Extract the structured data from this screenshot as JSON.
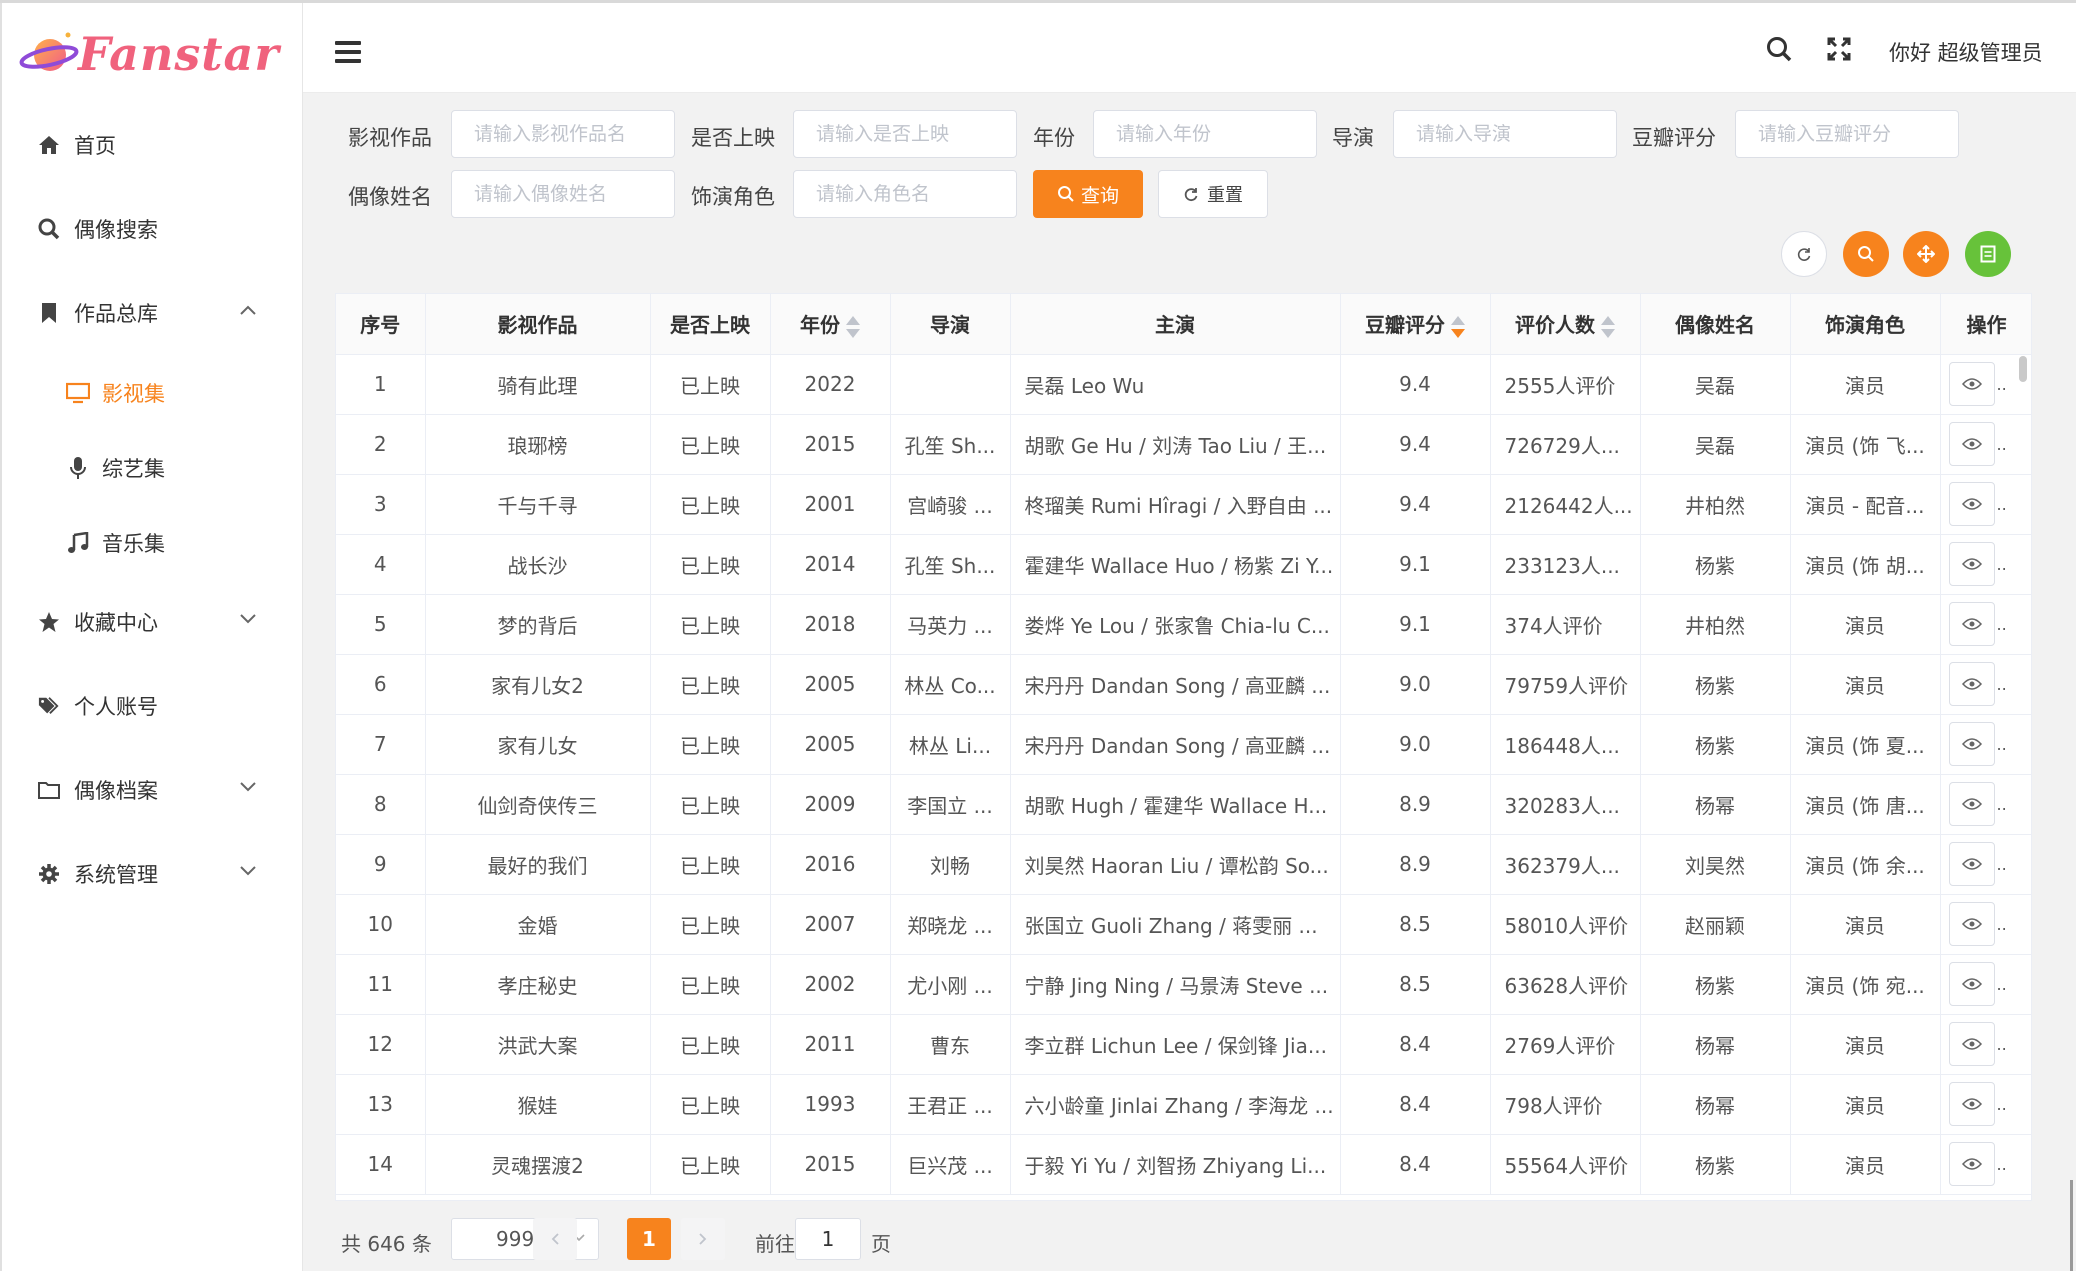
{
  "app": {
    "brand": "Fanstar"
  },
  "header": {
    "greeting": "你好 超级管理员"
  },
  "sidebar": {
    "items": [
      {
        "label": "首页"
      },
      {
        "label": "偶像搜索"
      },
      {
        "label": "作品总库"
      },
      {
        "label": "影视集"
      },
      {
        "label": "综艺集"
      },
      {
        "label": "音乐集"
      },
      {
        "label": "收藏中心"
      },
      {
        "label": "个人账号"
      },
      {
        "label": "偶像档案"
      },
      {
        "label": "系统管理"
      }
    ]
  },
  "filters": {
    "work": {
      "label": "影视作品",
      "placeholder": "请输入影视作品名"
    },
    "released": {
      "label": "是否上映",
      "placeholder": "请输入是否上映"
    },
    "year": {
      "label": "年份",
      "placeholder": "请输入年份"
    },
    "director": {
      "label": "导演",
      "placeholder": "请输入导演"
    },
    "rating": {
      "label": "豆瓣评分",
      "placeholder": "请输入豆瓣评分"
    },
    "idol": {
      "label": "偶像姓名",
      "placeholder": "请输入偶像姓名"
    },
    "role": {
      "label": "饰演角色",
      "placeholder": "请输入角色名"
    },
    "query_label": "查询",
    "reset_label": "重置"
  },
  "colors": {
    "accent": "#f7831d",
    "success": "#67c23a",
    "brand_pink": "#f0627d"
  },
  "table": {
    "headers": [
      "序号",
      "影视作品",
      "是否上映",
      "年份",
      "导演",
      "主演",
      "豆瓣评分",
      "评价人数",
      "偶像姓名",
      "饰演角色",
      "操作"
    ],
    "rows": [
      [
        "1",
        "骑有此理",
        "已上映",
        "2022",
        "",
        "吴磊 Leo Wu",
        "9.4",
        "2555人评价",
        "吴磊",
        "演员"
      ],
      [
        "2",
        "琅琊榜",
        "已上映",
        "2015",
        "孔笙 Sh...",
        "胡歌 Ge Hu / 刘涛 Tao Liu / 王...",
        "9.4",
        "726729人...",
        "吴磊",
        "演员 (饰 飞..."
      ],
      [
        "3",
        "千与千寻",
        "已上映",
        "2001",
        "宫崎骏 ...",
        "柊瑠美 Rumi Hîragi / 入野自由 ...",
        "9.4",
        "2126442人...",
        "井柏然",
        "演员 - 配音..."
      ],
      [
        "4",
        "战长沙",
        "已上映",
        "2014",
        "孔笙 Sh...",
        "霍建华 Wallace Huo / 杨紫 Zi Y...",
        "9.1",
        "233123人...",
        "杨紫",
        "演员 (饰 胡..."
      ],
      [
        "5",
        "梦的背后",
        "已上映",
        "2018",
        "马英力 ...",
        "娄烨 Ye Lou / 张家鲁 Chia-lu C...",
        "9.1",
        "374人评价",
        "井柏然",
        "演员"
      ],
      [
        "6",
        "家有儿女2",
        "已上映",
        "2005",
        "林丛 Co...",
        "宋丹丹 Dandan Song / 高亚麟 ...",
        "9.0",
        "79759人评价",
        "杨紫",
        "演员"
      ],
      [
        "7",
        "家有儿女",
        "已上映",
        "2005",
        "林丛 Li...",
        "宋丹丹 Dandan Song / 高亚麟 ...",
        "9.0",
        "186448人...",
        "杨紫",
        "演员 (饰 夏..."
      ],
      [
        "8",
        "仙剑奇侠传三",
        "已上映",
        "2009",
        "李国立 ...",
        "胡歌 Hugh / 霍建华 Wallace H...",
        "8.9",
        "320283人...",
        "杨幂",
        "演员 (饰 唐..."
      ],
      [
        "9",
        "最好的我们",
        "已上映",
        "2016",
        "刘畅",
        "刘昊然 Haoran Liu / 谭松韵 So...",
        "8.9",
        "362379人...",
        "刘昊然",
        "演员 (饰 余..."
      ],
      [
        "10",
        "金婚",
        "已上映",
        "2007",
        "郑晓龙 ...",
        "张国立 Guoli Zhang / 蒋雯丽 ...",
        "8.5",
        "58010人评价",
        "赵丽颖",
        "演员"
      ],
      [
        "11",
        "孝庄秘史",
        "已上映",
        "2002",
        "尤小刚 ...",
        "宁静 Jing Ning / 马景涛 Steve ...",
        "8.5",
        "63628人评价",
        "杨紫",
        "演员 (饰 宛..."
      ],
      [
        "12",
        "洪武大案",
        "已上映",
        "2011",
        "曹东",
        "李立群 Lichun Lee / 保剑锋 Jia...",
        "8.4",
        "2769人评价",
        "杨幂",
        "演员"
      ],
      [
        "13",
        "猴娃",
        "已上映",
        "1993",
        "王君正 ...",
        "六小龄童 Jinlai Zhang / 李海龙 ...",
        "8.4",
        "798人评价",
        "杨幂",
        "演员"
      ],
      [
        "14",
        "灵魂摆渡2",
        "已上映",
        "2015",
        "巨兴茂 ...",
        "于毅 Yi Yu / 刘智扬 Zhiyang Li...",
        "8.4",
        "55564人评价",
        "杨紫",
        "演员"
      ]
    ]
  },
  "pagination": {
    "total": "共 646 条",
    "page_size": "999",
    "current": "1",
    "goto_label": "前往",
    "goto_value": "1",
    "page_suffix": "页"
  }
}
